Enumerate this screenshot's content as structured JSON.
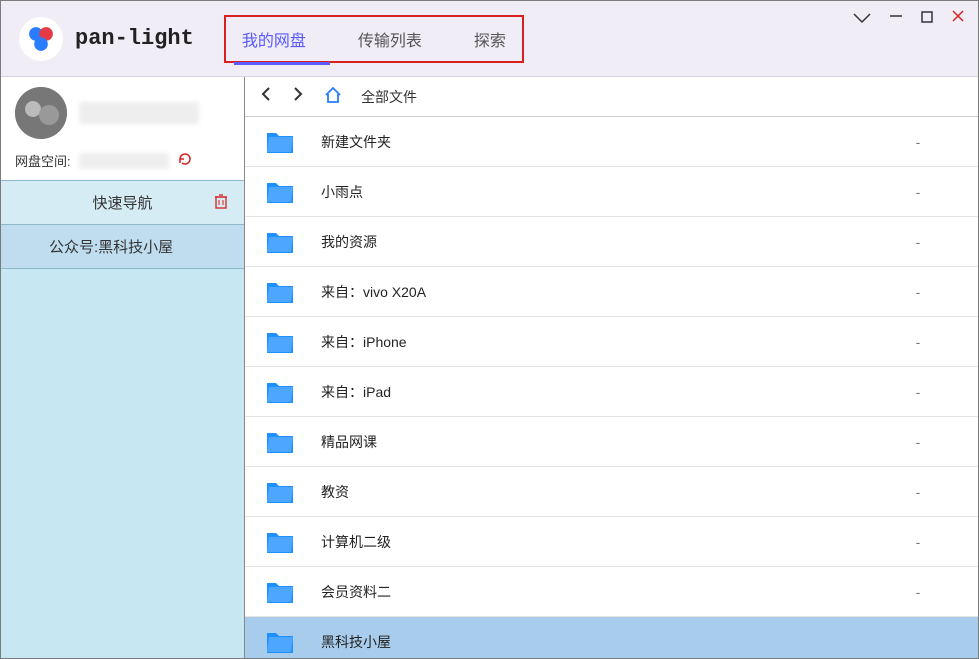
{
  "app": {
    "name": "pan-light"
  },
  "tabs": {
    "my_disk": "我的网盘",
    "transfer": "传输列表",
    "explore": "探索"
  },
  "sidebar": {
    "space_label": "网盘空间:",
    "quick_nav": "快速导航",
    "public_account_label": "公众号:",
    "public_account_value": "黑科技小屋"
  },
  "breadcrumb": {
    "path": "全部文件"
  },
  "files": [
    {
      "name": "新建文件夹",
      "meta": "-"
    },
    {
      "name": "小雨点",
      "meta": "-"
    },
    {
      "name": "我的资源",
      "meta": "-"
    },
    {
      "name": "来自：vivo X20A",
      "meta": "-"
    },
    {
      "name": "来自：iPhone",
      "meta": "-"
    },
    {
      "name": "来自：iPad",
      "meta": "-"
    },
    {
      "name": "精品网课",
      "meta": "-"
    },
    {
      "name": "教资",
      "meta": "-"
    },
    {
      "name": "计算机二级",
      "meta": "-"
    },
    {
      "name": "会员资料二",
      "meta": "-"
    },
    {
      "name": "黑科技小屋",
      "meta": ""
    }
  ]
}
